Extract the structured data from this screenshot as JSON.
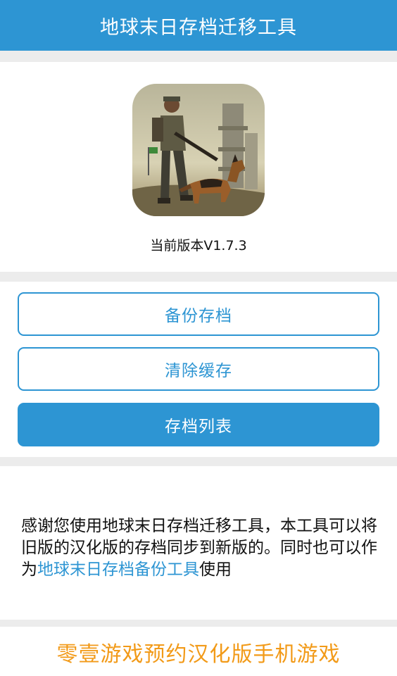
{
  "header": {
    "title": "地球末日存档迁移工具"
  },
  "app": {
    "icon": "survivor-with-dog-app-icon",
    "version_label": "当前版本V1.7.3"
  },
  "actions": {
    "backup_label": "备份存档",
    "clear_cache_label": "清除缓存",
    "save_list_label": "存档列表"
  },
  "description": {
    "text_before_link": "感谢您使用地球末日存档迁移工具，本工具可以将旧版的汉化版的存档同步到新版的。同时也可以作为",
    "link_text": "地球末日存档备份工具",
    "text_after_link": "使用"
  },
  "footer": {
    "link_text": "零壹游戏预约汉化版手机游戏"
  },
  "colors": {
    "primary": "#2d95d3",
    "accent_orange": "#f29a18",
    "background": "#ececec"
  }
}
